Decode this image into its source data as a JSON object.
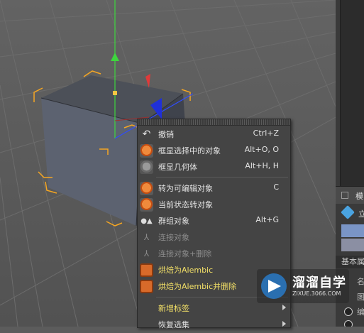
{
  "context_menu": {
    "items": [
      {
        "label": "撤销",
        "shortcut": "Ctrl+Z",
        "icon": "undo-icon",
        "state": "normal"
      },
      {
        "label": "框显选择中的对象",
        "shortcut": "Alt+O, O",
        "icon": "frame-selected-icon",
        "state": "normal"
      },
      {
        "label": "框显几何体",
        "shortcut": "Alt+H, H",
        "icon": "frame-geometry-icon",
        "state": "normal"
      },
      {
        "label": "转为可编辑对象",
        "shortcut": "C",
        "icon": "make-editable-icon",
        "state": "normal"
      },
      {
        "label": "当前状态转对象",
        "shortcut": "",
        "icon": "current-state-icon",
        "state": "normal"
      },
      {
        "label": "群组对象",
        "shortcut": "Alt+G",
        "icon": "group-objects-icon",
        "state": "normal"
      },
      {
        "label": "连接对象",
        "shortcut": "",
        "icon": "connect-objects-icon",
        "state": "disabled"
      },
      {
        "label": "连接对象+删除",
        "shortcut": "",
        "icon": "connect-delete-icon",
        "state": "disabled"
      },
      {
        "label": "烘焙为Alembic",
        "shortcut": "",
        "icon": "bake-alembic-icon",
        "state": "highlight"
      },
      {
        "label": "烘焙为Alembic并删除",
        "shortcut": "",
        "icon": "bake-alembic-delete-icon",
        "state": "highlight"
      },
      {
        "label": "新增标签",
        "shortcut": "",
        "icon": "",
        "state": "highlight",
        "submenu": true
      },
      {
        "label": "恢复选集",
        "shortcut": "",
        "icon": "",
        "state": "normal",
        "submenu": true
      }
    ]
  },
  "right_panel": {
    "tab_label": "模",
    "object_label": "立",
    "section_label": "基本属",
    "row1": "名",
    "row2": "图",
    "row3": "编"
  },
  "watermark": {
    "title": "溜溜自学",
    "url": "ZIXUE.3066.COM"
  },
  "colors": {
    "menu_bg": "#444444",
    "highlight_text": "#f3e067",
    "disabled_text": "#8c8c8c",
    "selection_orange": "#f5a623"
  }
}
